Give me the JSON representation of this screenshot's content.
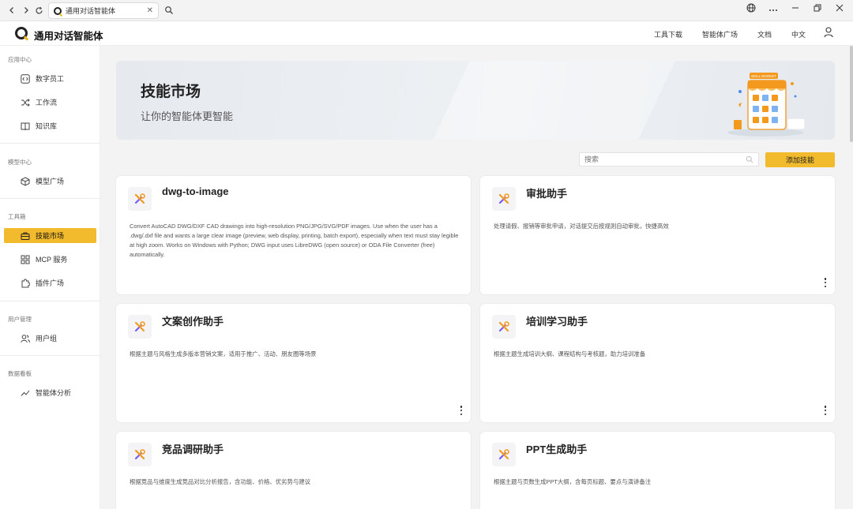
{
  "browser": {
    "tab_title": "通用对话智能体",
    "tab_close": "✕"
  },
  "header": {
    "app_title": "通用对话智能体",
    "nav": [
      "工具下载",
      "智能体广场",
      "文档",
      "中文"
    ]
  },
  "sidebar": {
    "sections": [
      {
        "title": "应用中心",
        "items": [
          {
            "label": "数字员工",
            "icon": "code-bracket-icon"
          },
          {
            "label": "工作流",
            "icon": "shuffle-icon"
          },
          {
            "label": "知识库",
            "icon": "book-icon"
          }
        ]
      },
      {
        "title": "模型中心",
        "items": [
          {
            "label": "模型广场",
            "icon": "cube-icon"
          }
        ]
      },
      {
        "title": "工具箱",
        "items": [
          {
            "label": "技能市场",
            "icon": "briefcase-icon",
            "active": true
          },
          {
            "label": "MCP 服务",
            "icon": "grid-icon"
          },
          {
            "label": "插件广场",
            "icon": "puzzle-icon"
          }
        ]
      },
      {
        "title": "用户管理",
        "items": [
          {
            "label": "用户组",
            "icon": "users-icon"
          }
        ]
      },
      {
        "title": "数据看板",
        "items": [
          {
            "label": "智能体分析",
            "icon": "trend-icon"
          }
        ]
      }
    ]
  },
  "banner": {
    "title": "技能市场",
    "subtitle": "让你的智能体更智能",
    "art_sign": "SKILL MARKET"
  },
  "toolbar": {
    "search_placeholder": "搜索",
    "add_label": "添加技能"
  },
  "cards": [
    {
      "title": "dwg-to-image",
      "desc": "Convert AutoCAD DWG/DXF CAD drawings into high-resolution PNG/JPG/SVG/PDF images. Use when the user has a .dwg/.dxf file and wants a large clear image (preview, web display, printing, batch export), especially when text must stay legible at high zoom. Works on Windows with Python; DWG input uses LibreDWG (open source) or ODA File Converter (free) automatically."
    },
    {
      "title": "审批助手",
      "desc": "处理请假、报销等审批申请，对话提交后按规则自动审批，快捷高效"
    },
    {
      "title": "文案创作助手",
      "desc": "根据主题与风格生成多版本营销文案，适用于推广、活动、朋友圈等场景"
    },
    {
      "title": "培训学习助手",
      "desc": "根据主题生成培训大纲、课程结构与考核题，助力培训准备"
    },
    {
      "title": "竞品调研助手",
      "desc": "根据竞品与维度生成竞品对比分析报告，含功能、价格、优劣势与建议"
    },
    {
      "title": "PPT生成助手",
      "desc": "根据主题与页数生成PPT大纲，含每页标题、要点与演讲备注"
    }
  ],
  "colors": {
    "accent": "#f2bb2d",
    "card_icon_orange": "#f39a1e",
    "card_icon_purple": "#7a5cf0"
  }
}
